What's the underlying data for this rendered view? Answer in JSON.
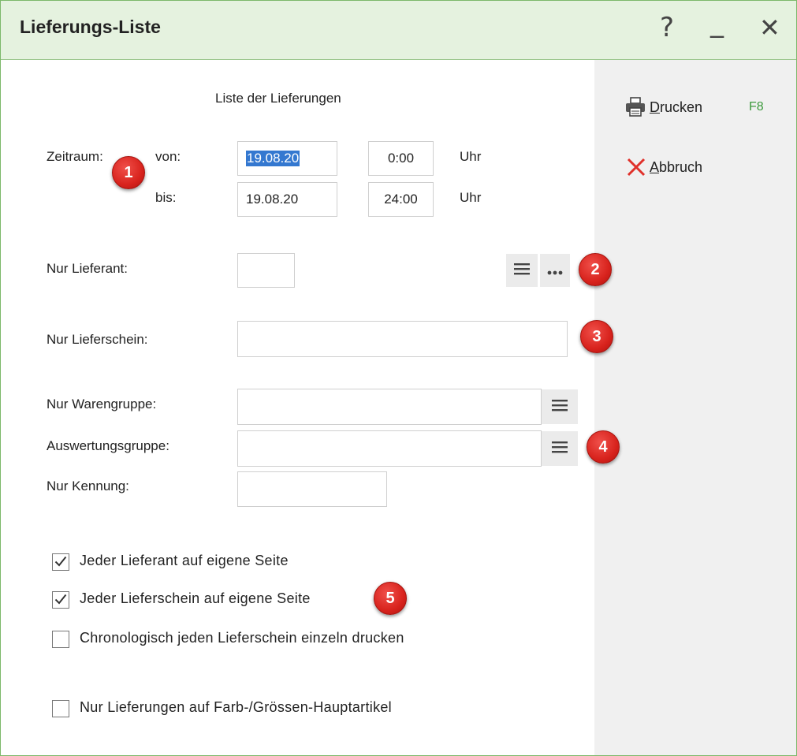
{
  "window": {
    "title": "Lieferungs-Liste",
    "help_glyph": "?",
    "minimize_glyph": "_",
    "close_glyph": "✕"
  },
  "form": {
    "heading": "Liste der Lieferungen",
    "zeitraum_label": "Zeitraum:",
    "von_label": "von:",
    "bis_label": "bis:",
    "von_date": "19.08.20",
    "von_time": "0:00",
    "bis_date": "19.08.20",
    "bis_time": "24:00",
    "uhr_label": "Uhr",
    "nur_lieferant_label": "Nur Lieferant:",
    "nur_lieferant_value": "",
    "nur_lieferschein_label": "Nur Lieferschein:",
    "nur_lieferschein_value": "",
    "nur_warengruppe_label": "Nur Warengruppe:",
    "nur_warengruppe_value": "",
    "auswertungsgruppe_label": "Auswertungsgruppe:",
    "auswertungsgruppe_value": "",
    "nur_kennung_label": "Nur Kennung:",
    "nur_kennung_value": ""
  },
  "checkboxes": [
    {
      "label": "Jeder Lieferant auf eigene Seite",
      "checked": true
    },
    {
      "label": "Jeder Lieferschein auf eigene Seite",
      "checked": true
    },
    {
      "label": "Chronologisch jeden Lieferschein einzeln drucken",
      "checked": false
    },
    {
      "label": "Nur Lieferungen auf Farb-/Grössen-Hauptartikel",
      "checked": false
    }
  ],
  "sidebar": {
    "print": {
      "label_first": "D",
      "label_rest": "rucken",
      "shortcut": "F8",
      "icon": "printer-icon"
    },
    "cancel": {
      "label_first": "A",
      "label_rest": "bbruch",
      "icon": "cancel-x-icon",
      "icon_color": "#e0302a"
    }
  },
  "badges": [
    "1",
    "2",
    "3",
    "4",
    "5"
  ],
  "colors": {
    "titlebar_bg": "#e5f2df",
    "border": "#7cb86a",
    "selection": "#3478d0",
    "shortcut": "#3c9a3c",
    "badge": "#d8231d"
  }
}
